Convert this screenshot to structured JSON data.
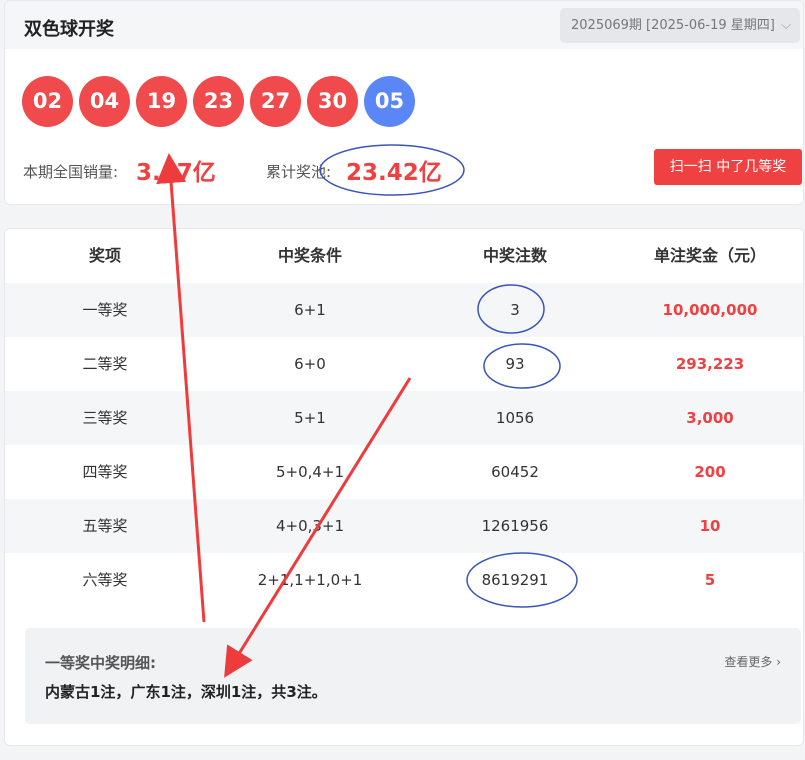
{
  "header": {
    "title": "双色球开奖",
    "issue_select": "2025069期 [2025-06-19 星期四]"
  },
  "draw": {
    "red_balls": [
      "02",
      "04",
      "19",
      "23",
      "27",
      "30"
    ],
    "blue_ball": "05"
  },
  "stats": {
    "sales_label": "本期全国销量:",
    "sales_value": "3.67亿",
    "pool_label": "累计奖池:",
    "pool_value": "23.42亿"
  },
  "scan_button": "扫一扫 中了几等奖",
  "table": {
    "headers": [
      "奖项",
      "中奖条件",
      "中奖注数",
      "单注奖金（元）"
    ],
    "rows": [
      {
        "level": "一等奖",
        "condition": "6+1",
        "count": "3",
        "prize": "10,000,000"
      },
      {
        "level": "二等奖",
        "condition": "6+0",
        "count": "93",
        "prize": "293,223"
      },
      {
        "level": "三等奖",
        "condition": "5+1",
        "count": "1056",
        "prize": "3,000"
      },
      {
        "level": "四等奖",
        "condition": "5+0,4+1",
        "count": "60452",
        "prize": "200"
      },
      {
        "level": "五等奖",
        "condition": "4+0,3+1",
        "count": "1261956",
        "prize": "10"
      },
      {
        "level": "六等奖",
        "condition": "2+1,1+1,0+1",
        "count": "8619291",
        "prize": "5"
      }
    ]
  },
  "detail": {
    "title": "一等奖中奖明细:",
    "more": "查看更多",
    "text": "内蒙古1注，广东1注，深圳1注，共3注。"
  },
  "colors": {
    "red_ball": "#f04a4c",
    "blue_ball": "#5b86f5",
    "accent": "#ef4042",
    "annotation_blue": "#3a55b8",
    "annotation_red": "#ee3b3b"
  }
}
